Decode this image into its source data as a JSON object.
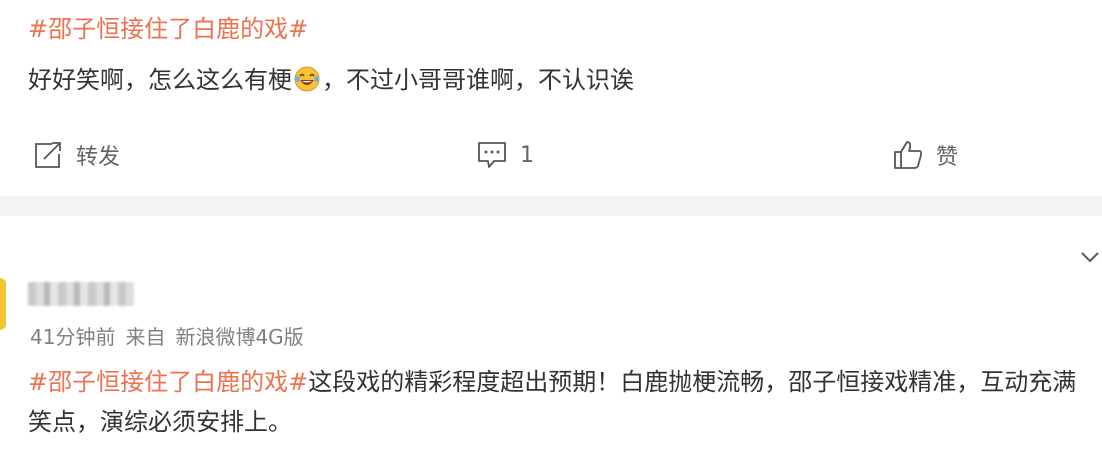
{
  "post1": {
    "topic": "#邵子恒接住了白鹿的戏#",
    "body_before_emoji": "好好笑啊，怎么这么有梗",
    "emoji": "laughing-tears-emoji",
    "body_after_emoji": "，不过小哥哥谁啊，不认识诶",
    "actions": {
      "repost_label": "转发",
      "comment_count": "1",
      "like_label": "赞"
    }
  },
  "post2": {
    "time": "41分钟前",
    "source_prefix": "来自",
    "source": "新浪微博4G版",
    "topic": "#邵子恒接住了白鹿的戏#",
    "body": "这段戏的精彩程度超出预期！白鹿抛梗流畅，邵子恒接戏精准，互动充满笑点，演综必须安排上。"
  },
  "icons": {
    "repost": "repost-icon",
    "comment": "comment-icon",
    "like": "thumbs-up-icon",
    "expand": "chevron-down-icon"
  },
  "colors": {
    "topic": "#eb7350",
    "text": "#333333",
    "meta": "#808080",
    "separator": "#f3f3f5",
    "avatar_accent": "#f5c431"
  }
}
